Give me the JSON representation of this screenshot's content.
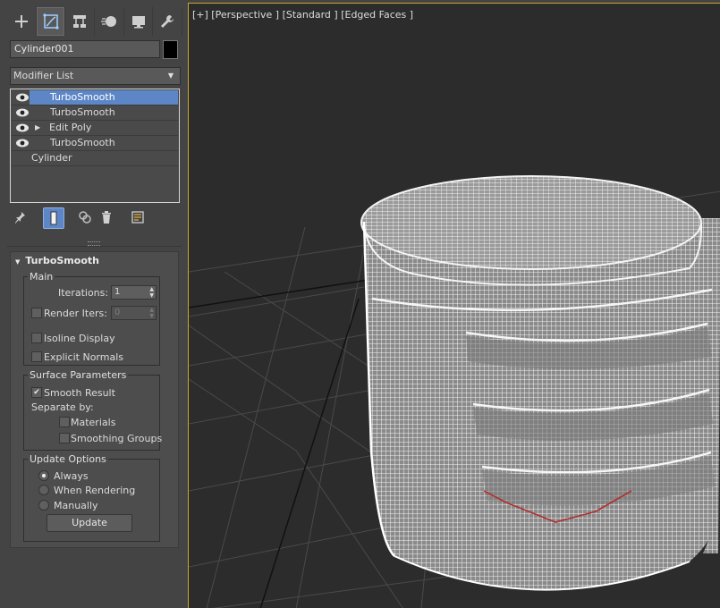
{
  "command_panel": {
    "tabs": [
      {
        "name": "create",
        "icon": "plus-icon"
      },
      {
        "name": "modify",
        "icon": "modify-icon",
        "active": true
      },
      {
        "name": "hierarchy",
        "icon": "hierarchy-icon"
      },
      {
        "name": "motion",
        "icon": "motion-icon"
      },
      {
        "name": "display",
        "icon": "display-icon"
      },
      {
        "name": "utilities",
        "icon": "wrench-icon"
      }
    ],
    "object_name": "Cylinder001",
    "object_color": "#000000",
    "modifier_list_label": "Modifier List",
    "stack": [
      {
        "label": "TurboSmooth",
        "visible": true,
        "selected": true
      },
      {
        "label": "TurboSmooth",
        "visible": true
      },
      {
        "label": "Edit Poly",
        "visible": true,
        "expandable": true
      },
      {
        "label": "TurboSmooth",
        "visible": true
      },
      {
        "label": "Cylinder",
        "base": true
      }
    ]
  },
  "turbosmooth": {
    "title": "TurboSmooth",
    "main": {
      "title": "Main",
      "iterations_label": "Iterations:",
      "iterations_value": "1",
      "render_iters_label": "Render Iters:",
      "render_iters_value": "0",
      "isoline_display_label": "Isoline Display",
      "explicit_normals_label": "Explicit Normals"
    },
    "surface": {
      "title": "Surface Parameters",
      "smooth_result_label": "Smooth Result",
      "smooth_result_checked": "✔",
      "separate_by_label": "Separate by:",
      "materials_label": "Materials",
      "smoothing_groups_label": "Smoothing Groups"
    },
    "update_options": {
      "title": "Update Options",
      "always_label": "Always",
      "when_rendering_label": "When Rendering",
      "manually_label": "Manually",
      "update_button": "Update",
      "selected": "Always"
    }
  },
  "viewport": {
    "label": "[+] [Perspective ] [Standard ] [Edged Faces ]",
    "active_border_color": "#c9a72a",
    "background": "#2c2c2c"
  },
  "colors": {
    "panel_bg": "#444444",
    "selection": "#5d86c7"
  }
}
